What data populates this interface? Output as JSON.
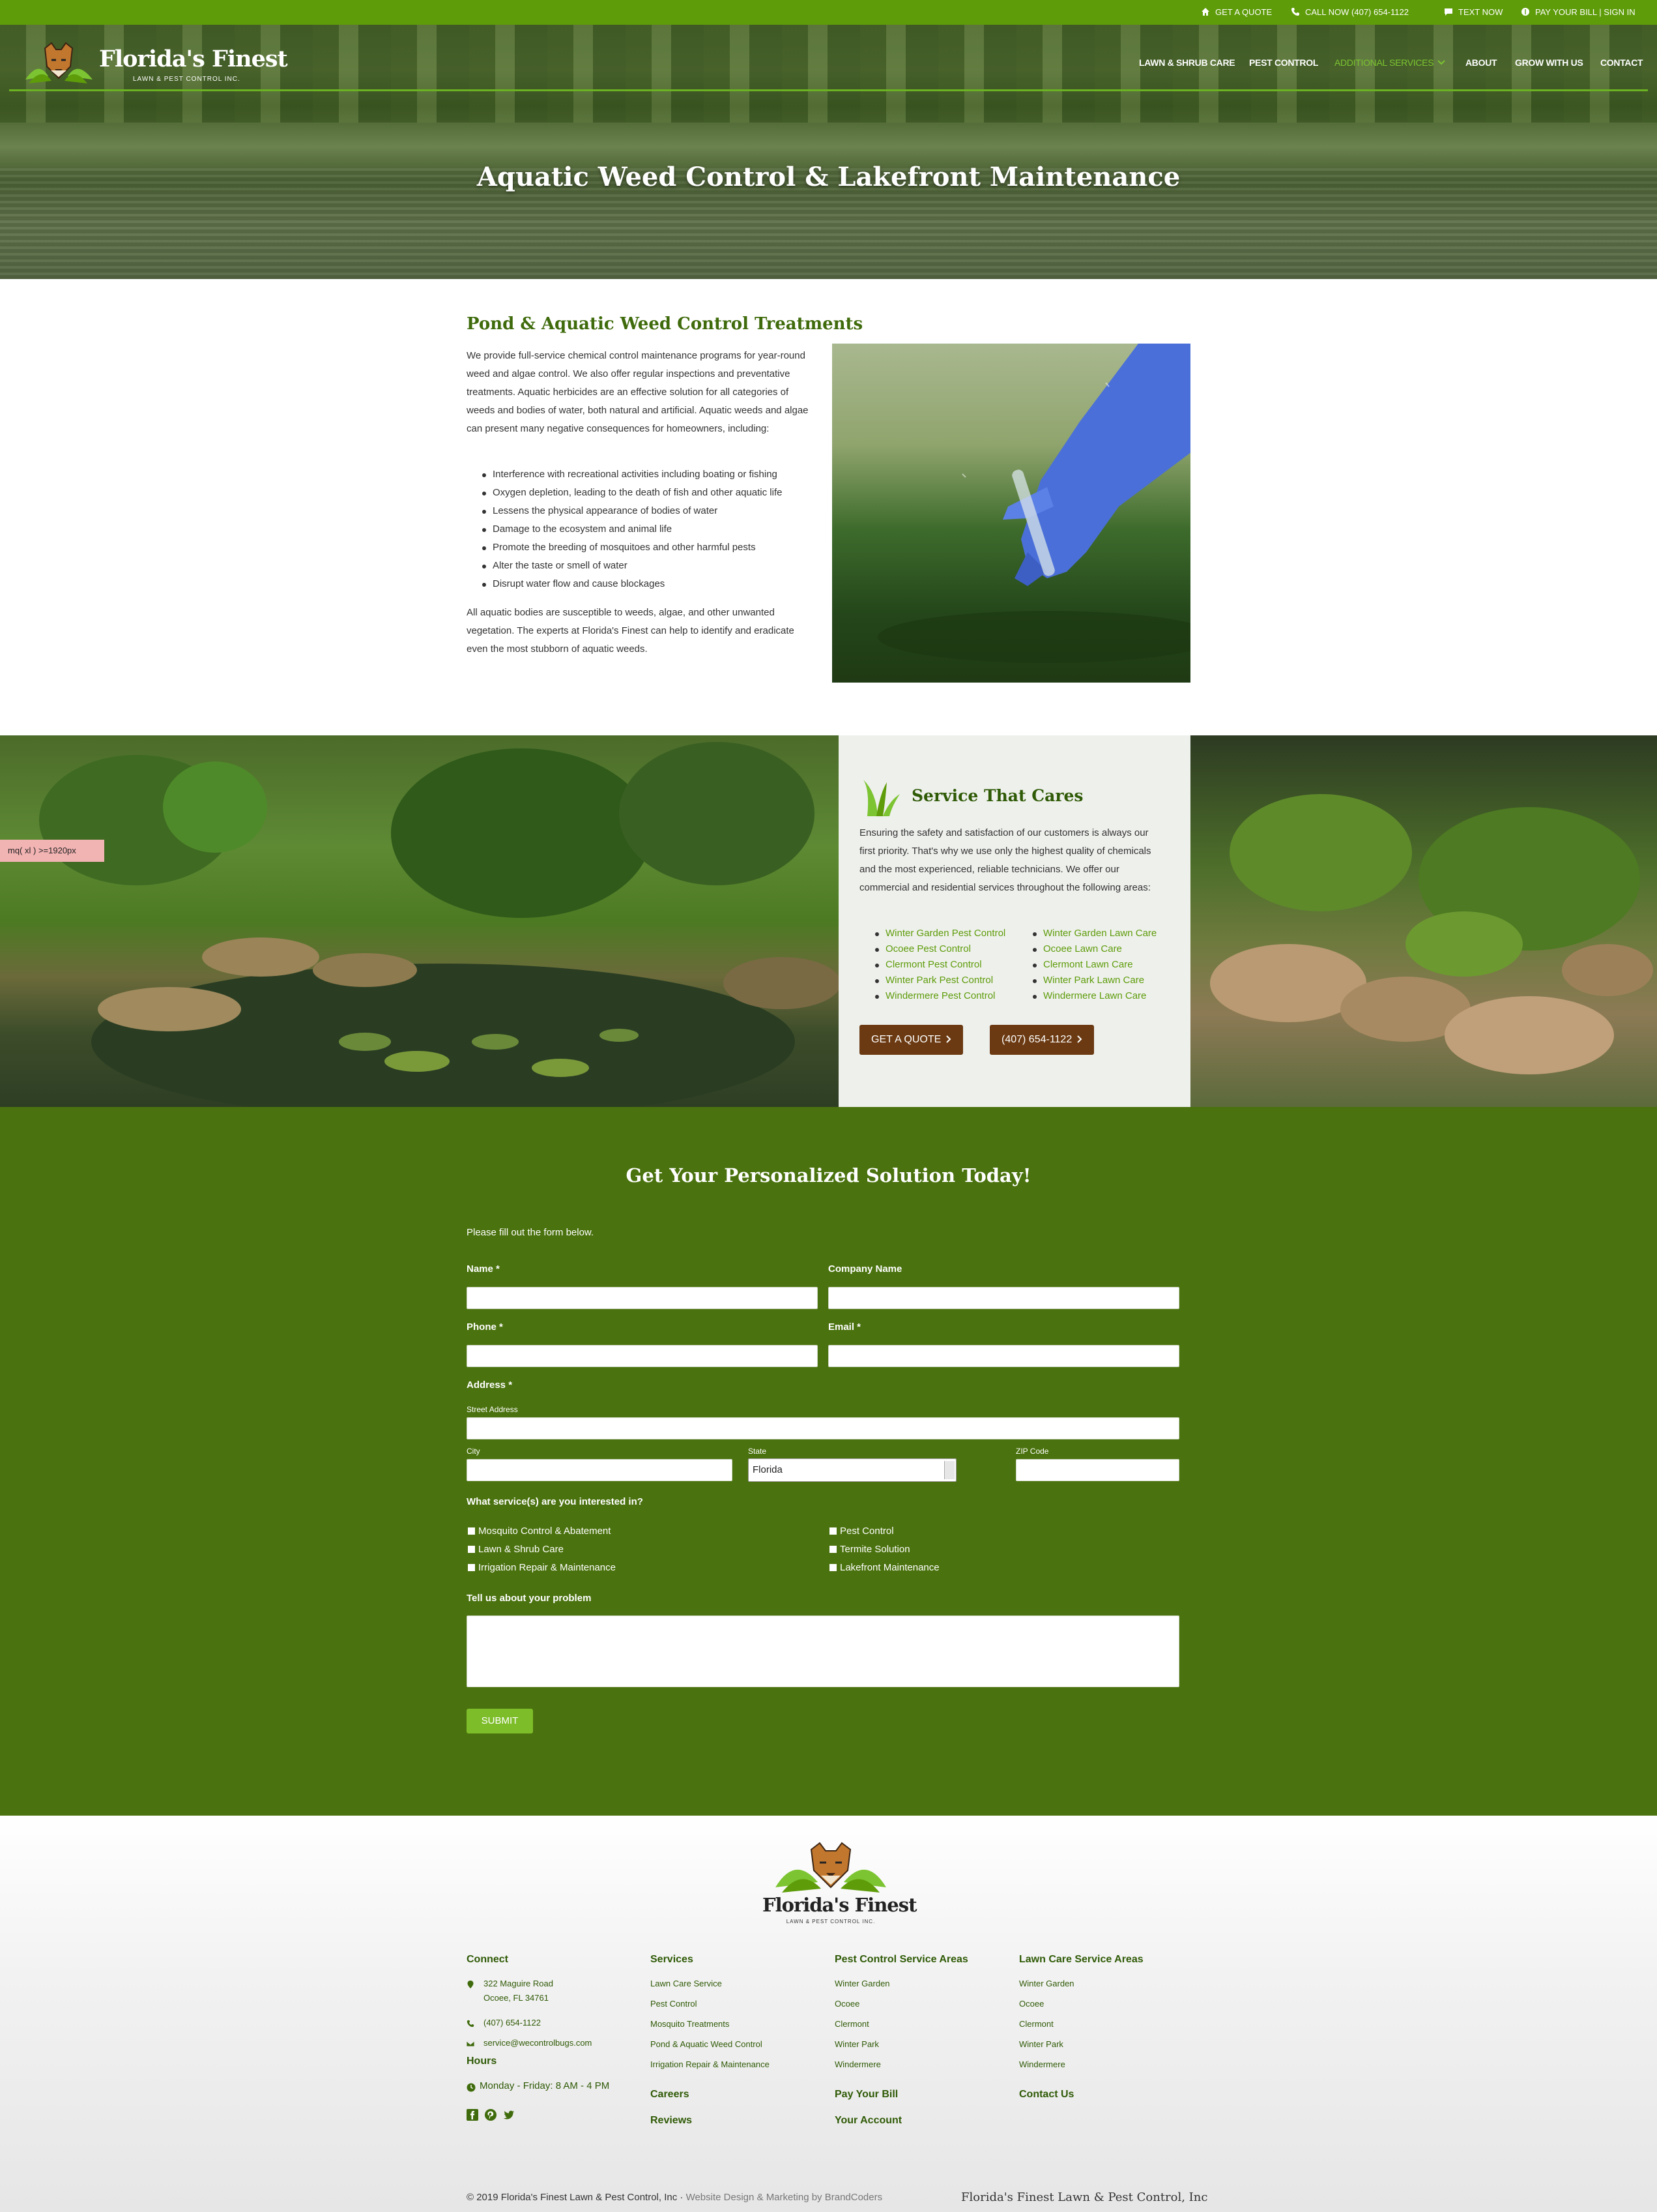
{
  "topbar": {
    "quote": "GET A QUOTE",
    "call": "CALL NOW (407) 654-1122",
    "text": "TEXT NOW",
    "bill": "PAY YOUR BILL | SIGN IN"
  },
  "brand": {
    "name": "Florida's Finest",
    "tagline": "LAWN & PEST CONTROL INC."
  },
  "nav": [
    {
      "label": "LAWN & SHRUB CARE"
    },
    {
      "label": "PEST CONTROL"
    },
    {
      "label": "ADDITIONAL SERVICES"
    },
    {
      "label": "ABOUT"
    },
    {
      "label": "GROW WITH US"
    },
    {
      "label": "CONTACT"
    }
  ],
  "hero": {
    "title": "Aquatic Weed Control & Lakefront Maintenance"
  },
  "pond": {
    "heading": "Pond & Aquatic Weed Control Treatments",
    "intro": "We provide full-service chemical control maintenance programs for year-round weed and algae control. We also offer regular inspections and preventative treatments. Aquatic herbicides are an effective solution for all categories of weeds and bodies of water, both natural and artificial. Aquatic weeds and algae can present many negative consequences for homeowners, including:",
    "bullets": [
      "Interference with recreational activities including boating or fishing",
      "Oxygen depletion, leading to the death of fish and other aquatic life",
      "Lessens the physical appearance of bodies of water",
      "Damage to the ecosystem and animal life",
      "Promote the breeding of mosquitoes and other harmful pests",
      "Alter the taste or smell of water",
      "Disrupt water flow and cause blockages"
    ],
    "outro": "All aquatic bodies are susceptible to weeds, algae, and other unwanted vegetation. The experts at Florida's Finest can help to identify and eradicate even the most stubborn of aquatic weeds."
  },
  "cares": {
    "title": "Service That Cares",
    "text": "Ensuring the safety and satisfaction of our customers is always our first priority. That's why we use only the highest quality of chemicals and the most experienced, reliable technicians. We offer our commercial and residential services throughout the following areas:",
    "pest_areas": [
      "Winter Garden Pest Control",
      "Ocoee Pest Control",
      "Clermont Pest Control",
      "Winter Park Pest Control",
      "Windermere Pest Control"
    ],
    "lawn_areas": [
      "Winter Garden Lawn Care",
      "Ocoee Lawn Care",
      "Clermont Lawn Care",
      "Winter Park Lawn Care",
      "Windermere Lawn Care"
    ],
    "btn_quote": "GET A QUOTE",
    "btn_phone": "(407) 654-1122"
  },
  "debug_badge": "mq( xl ) >=1920px",
  "form": {
    "title": "Get Your Personalized Solution Today!",
    "intro": "Please fill out the form below.",
    "name_label": "Name *",
    "company_label": "Company Name",
    "phone_label": "Phone *",
    "email_label": "Email *",
    "address_label": "Address *",
    "street_label": "Street Address",
    "city_label": "City",
    "state_label": "State",
    "state_value": "Florida",
    "zip_label": "ZIP Code",
    "services_label": "What service(s) are you interested in?",
    "services_left": [
      "Mosquito Control & Abatement",
      "Lawn & Shrub Care",
      "Irrigation Repair & Maintenance"
    ],
    "services_right": [
      "Pest Control",
      "Termite Solution",
      "Lakefront Maintenance"
    ],
    "problem_label": "Tell us about your problem",
    "submit": "SUBMIT"
  },
  "footer": {
    "connect": {
      "heading": "Connect",
      "address1": "322 Maguire Road",
      "address2": "Ocoee, FL 34761",
      "phone": "(407) 654-1122",
      "email": "service@wecontrolbugs.com",
      "hours_heading": "Hours",
      "hours": "Monday - Friday: 8 AM - 4 PM"
    },
    "services": {
      "heading": "Services",
      "links": [
        "Lawn Care Service",
        "Pest Control",
        "Mosquito Treatments",
        "Pond & Aquatic Weed Control",
        "Irrigation Repair & Maintenance"
      ],
      "careers": "Careers",
      "reviews": "Reviews"
    },
    "pest_areas": {
      "heading": "Pest Control Service Areas",
      "links": [
        "Winter Garden",
        "Ocoee",
        "Clermont",
        "Winter Park",
        "Windermere"
      ],
      "pay": "Pay Your Bill",
      "account": "Your Account"
    },
    "lawn_areas": {
      "heading": "Lawn Care Service Areas",
      "links": [
        "Winter Garden",
        "Ocoee",
        "Clermont",
        "Winter Park",
        "Windermere"
      ],
      "contact": "Contact Us"
    },
    "copyright": "© 2019 Florida's Finest Lawn & Pest Control, Inc ·",
    "credit": "Website Design & Marketing by BrandCoders",
    "corp": "Florida's Finest Lawn & Pest Control, Inc"
  },
  "colors": {
    "brand_green": "#5e9c0a",
    "dark_green": "#4a720e",
    "heading_green": "#3f6b0c",
    "button_brown": "#6b3a12",
    "submit_green": "#7dbd2a"
  }
}
